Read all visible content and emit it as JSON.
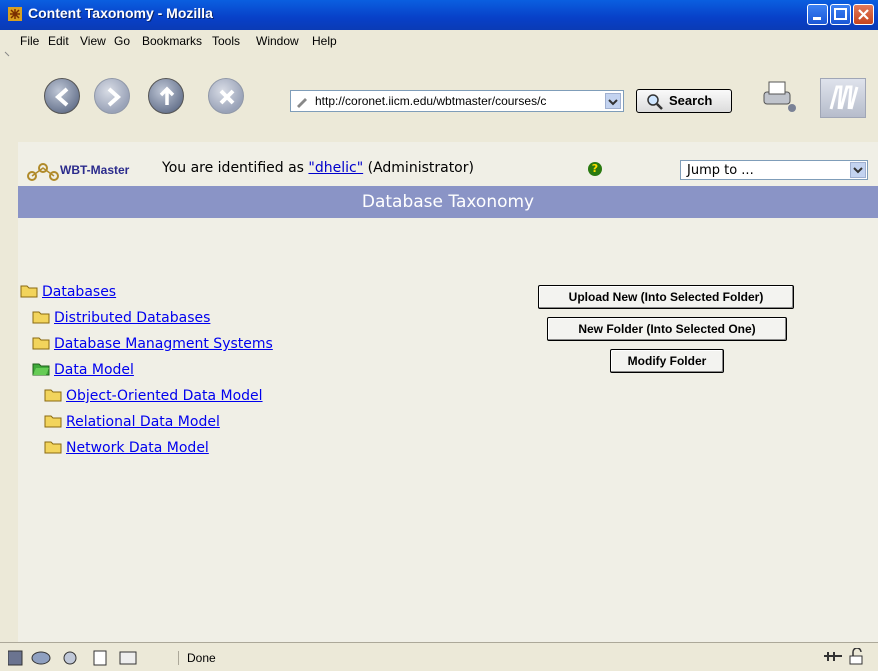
{
  "window": {
    "title": "Content Taxonomy - Mozilla"
  },
  "menu": {
    "items": [
      "File",
      "Edit",
      "View",
      "Go",
      "Bookmarks",
      "Tools",
      "Window",
      "Help"
    ]
  },
  "navbar": {
    "url": "http://coronet.iicm.edu/wbtmaster/courses/c",
    "search_label": "Search"
  },
  "page": {
    "logo_label": "WBT-Master",
    "identified_prefix": "You are identified as",
    "user": "\"dhelic\"",
    "role": "(Administrator)",
    "jump_to": "Jump to ...",
    "banner": "Database Taxonomy"
  },
  "tree": [
    {
      "label": "Databases",
      "level": 0,
      "open": false
    },
    {
      "label": "Distributed Databases",
      "level": 1,
      "open": false
    },
    {
      "label": "Database Managment Systems",
      "level": 1,
      "open": false
    },
    {
      "label": "Data Model",
      "level": 1,
      "open": true
    },
    {
      "label": "Object-Oriented Data Model",
      "level": 2,
      "open": false
    },
    {
      "label": "Relational Data Model",
      "level": 2,
      "open": false
    },
    {
      "label": "Network Data Model",
      "level": 2,
      "open": false
    }
  ],
  "actions": {
    "upload": "Upload New (Into Selected Folder)",
    "new_folder": "New Folder (Into Selected One)",
    "modify": "Modify Folder"
  },
  "status": {
    "text": "Done"
  },
  "colors": {
    "banner": "#8a94c6",
    "link": "#0000ee",
    "titlebar": "#0840c8"
  }
}
